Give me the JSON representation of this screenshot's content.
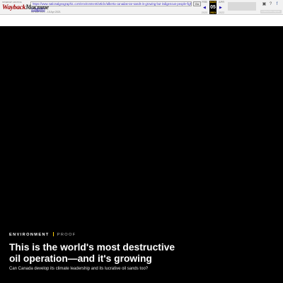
{
  "wayback": {
    "logo_top": "INTERNET ARCHIVE",
    "logo_a": "Wayback",
    "logo_b": "Machine",
    "url": "https://www.nationalgeographic.com/environment/article/alberta-canadas-tar-sands-is-growing-but-indigenous-people-fight-back",
    "go_label": "Go",
    "captures": "4 captures",
    "range": "05 Mar 2021 - 15 Apr 2021",
    "months": [
      "FEB",
      "MAR",
      "APR"
    ],
    "current_month": "MAR",
    "day": "05",
    "years": [
      "2020",
      "2021",
      "2022"
    ],
    "current_year": "2021",
    "timeline_label": "▌▌▌▌▌▌▌▌▌",
    "about_label": "▸ About this capture",
    "icons": [
      "login-icon",
      "help-icon",
      "facebook-icon",
      "twitter-icon"
    ]
  },
  "article": {
    "kicker": "ENVIRONMENT",
    "kicker_sub": "PROOF",
    "headline": "This is the world's most destructive oil operation—and it's growing",
    "dek": "Can Canada develop its climate leadership and its lucrative oil sands too?"
  },
  "colors": {
    "hero_bg": "#000000",
    "kicker_separator": "#ffcc00",
    "wayback_red": "#a00000"
  }
}
